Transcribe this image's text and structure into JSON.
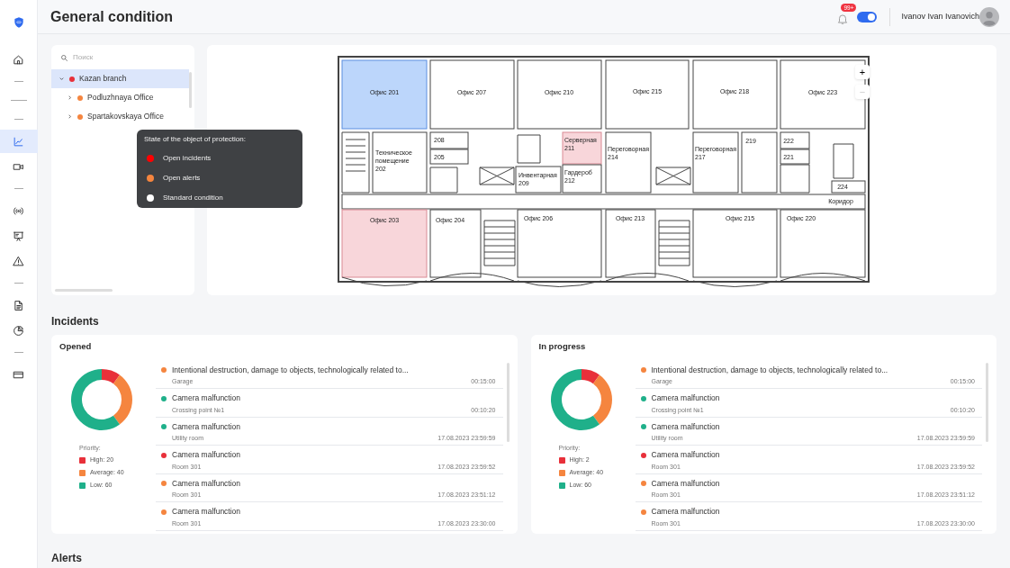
{
  "header": {
    "title": "General condition",
    "notifications": {
      "badge": "99+"
    },
    "toggle": {
      "on": true
    },
    "user": {
      "name": "Ivanov Ivan Ivanovich"
    }
  },
  "nav": [
    {
      "kind": "home",
      "selected": false
    },
    {
      "kind": "divider"
    },
    {
      "kind": "divider"
    },
    {
      "kind": "divider"
    },
    {
      "kind": "chart",
      "selected": true
    },
    {
      "kind": "video",
      "selected": false
    },
    {
      "kind": "divider"
    },
    {
      "kind": "broadcast",
      "selected": false
    },
    {
      "kind": "presentation",
      "selected": false
    },
    {
      "kind": "warning",
      "selected": false
    },
    {
      "kind": "divider"
    },
    {
      "kind": "document",
      "selected": false
    },
    {
      "kind": "pie",
      "selected": false
    },
    {
      "kind": "divider"
    },
    {
      "kind": "card",
      "selected": false
    }
  ],
  "tree": {
    "search": {
      "placeholder": "Поиск"
    },
    "items": [
      {
        "label": "Kazan branch",
        "color": "#e8303a",
        "expanded": true,
        "selected": true,
        "children": [
          {
            "label": "Podluzhnaya Office",
            "color": "#f5853f",
            "expanded": false,
            "selected": false
          },
          {
            "label": "Spartakovskaya Office",
            "color": "#f5853f",
            "expanded": false,
            "selected": false
          }
        ]
      }
    ]
  },
  "state_legend": {
    "title": "State of the object of protection:",
    "items": [
      {
        "label": "Open incidents",
        "color": "#ff0000"
      },
      {
        "label": "Open alerts",
        "color": "#f5853f"
      },
      {
        "label": "Standard condition",
        "color": "#ffffff"
      }
    ]
  },
  "floor_plan": {
    "rooms": [
      {
        "label": "Офис 201",
        "selected": true,
        "alert": false
      },
      {
        "label": "Офис 207",
        "selected": false,
        "alert": false
      },
      {
        "label": "Офис 210",
        "selected": false,
        "alert": false
      },
      {
        "label": "Офис 215",
        "selected": false,
        "alert": false
      },
      {
        "label": "Офис 218",
        "selected": false,
        "alert": false
      },
      {
        "label": "Офис 223",
        "selected": false,
        "alert": false
      },
      {
        "label": "Техническое\nпомещение\n202",
        "selected": false,
        "alert": false
      },
      {
        "label": "208",
        "selected": false,
        "alert": false
      },
      {
        "label": "205",
        "selected": false,
        "alert": false
      },
      {
        "label": "Инвентарная\n209",
        "selected": false,
        "alert": false
      },
      {
        "label": "Серверная\n211",
        "selected": false,
        "alert": true
      },
      {
        "label": "Гардероб\n212",
        "selected": false,
        "alert": false
      },
      {
        "label": "Переговорная\n214",
        "selected": false,
        "alert": false
      },
      {
        "label": "Переговорная\n217",
        "selected": false,
        "alert": false
      },
      {
        "label": "219",
        "selected": false,
        "alert": false
      },
      {
        "label": "222",
        "selected": false,
        "alert": false
      },
      {
        "label": "221",
        "selected": false,
        "alert": false
      },
      {
        "label": "224",
        "selected": false,
        "alert": false
      },
      {
        "label": "Коридор",
        "selected": false,
        "alert": false
      },
      {
        "label": "Офис 203",
        "selected": false,
        "alert": true
      },
      {
        "label": "Офис 204",
        "selected": false,
        "alert": false
      },
      {
        "label": "Офис 206",
        "selected": false,
        "alert": false
      },
      {
        "label": "Офис 213",
        "selected": false,
        "alert": false
      },
      {
        "label": "Офис 215",
        "selected": false,
        "alert": false
      },
      {
        "label": "Офис 220",
        "selected": false,
        "alert": false
      }
    ],
    "zoom_controls": [
      {
        "label": "+",
        "disabled": false
      },
      {
        "label": "−",
        "disabled": true
      }
    ]
  },
  "incidents": {
    "title": "Incidents",
    "panels": [
      {
        "title": "Opened",
        "chart_data": {
          "type": "donut",
          "series": [
            {
              "values": [
                10,
                30,
                60
              ]
            }
          ]
        },
        "legend": {
          "title": "Priority:",
          "items": [
            {
              "label": "High: 20",
              "color": "#e8303a"
            },
            {
              "label": "Average: 40",
              "color": "#f5853f"
            },
            {
              "label": "Low: 60",
              "color": "#1fb08a"
            }
          ]
        },
        "rows": [
          {
            "title": "Intentional destruction, damage to objects,  technologically related to...",
            "place": "Garage",
            "time": "00:15:00",
            "color": "#f5853f"
          },
          {
            "title": "Camera malfunction",
            "place": "Crossing point №1",
            "time": "00:10:20",
            "color": "#1fb08a"
          },
          {
            "title": "Camera malfunction",
            "place": "Utility room",
            "time": "17.08.2023 23:59:59",
            "color": "#1fb08a"
          },
          {
            "title": "Camera malfunction",
            "place": "Room 301",
            "time": "17.08.2023 23:59:52",
            "color": "#e8303a"
          },
          {
            "title": "Camera malfunction",
            "place": "Room 301",
            "time": "17.08.2023 23:51:12",
            "color": "#f5853f"
          },
          {
            "title": "Camera malfunction",
            "place": "Room 301",
            "time": "17.08.2023 23:30:00",
            "color": "#f5853f"
          }
        ]
      },
      {
        "title": "In progress",
        "chart_data": {
          "type": "donut",
          "series": [
            {
              "values": [
                10,
                30,
                60
              ]
            }
          ]
        },
        "legend": {
          "title": "Priority:",
          "items": [
            {
              "label": "High: 2",
              "color": "#e8303a"
            },
            {
              "label": "Average: 40",
              "color": "#f5853f"
            },
            {
              "label": "Low: 60",
              "color": "#1fb08a"
            }
          ]
        },
        "rows": [
          {
            "title": "Intentional destruction, damage to objects,  technologically related to...",
            "place": "Garage",
            "time": "00:15:00",
            "color": "#f5853f"
          },
          {
            "title": "Camera malfunction",
            "place": "Crossing point №1",
            "time": "00:10:20",
            "color": "#1fb08a"
          },
          {
            "title": "Camera malfunction",
            "place": "Utility room",
            "time": "17.08.2023 23:59:59",
            "color": "#1fb08a"
          },
          {
            "title": "Camera malfunction",
            "place": "Room 301",
            "time": "17.08.2023 23:59:52",
            "color": "#e8303a"
          },
          {
            "title": "Camera malfunction",
            "place": "Room 301",
            "time": "17.08.2023 23:51:12",
            "color": "#f5853f"
          },
          {
            "title": "Camera malfunction",
            "place": "Room 301",
            "time": "17.08.2023 23:30:00",
            "color": "#f5853f"
          }
        ]
      }
    ]
  },
  "alerts": {
    "title": "Alerts"
  }
}
